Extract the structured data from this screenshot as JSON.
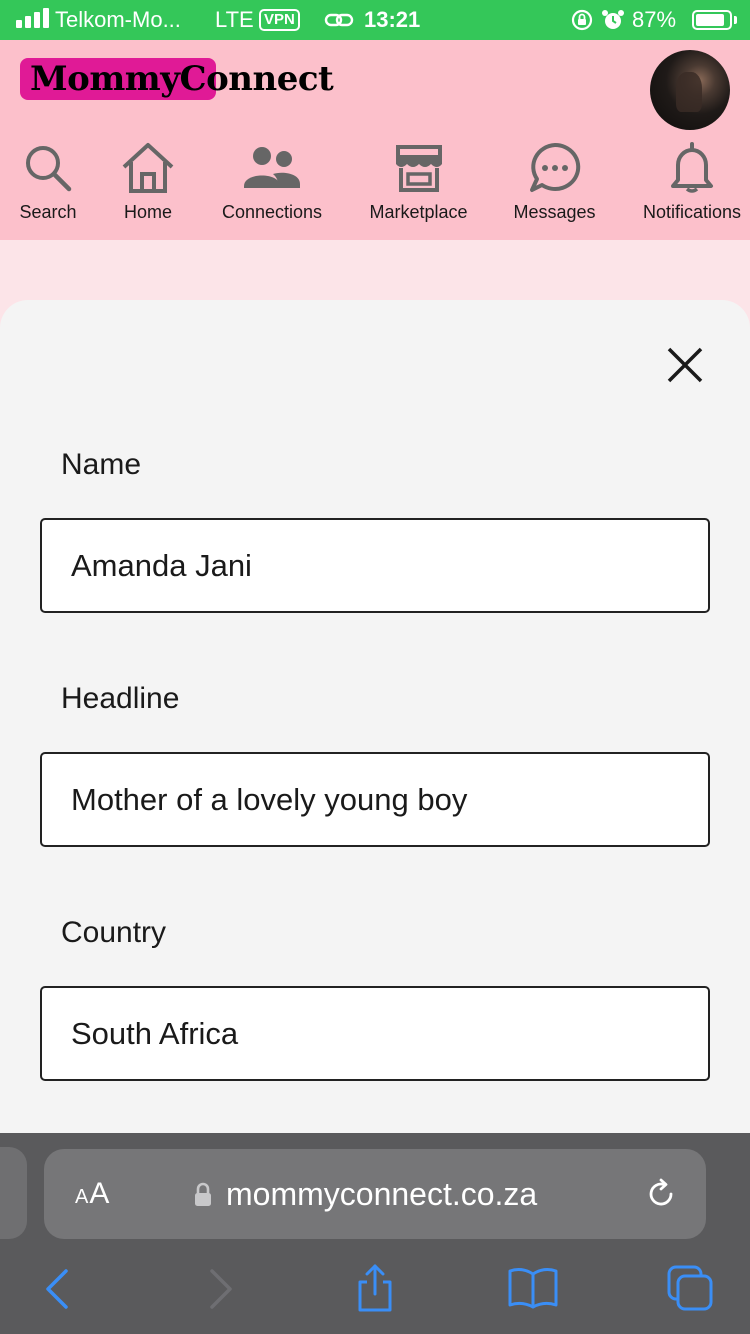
{
  "status_bar": {
    "carrier": "Telkom-Mo...",
    "network": "LTE",
    "vpn": "VPN",
    "time": "13:21",
    "battery": "87%",
    "battery_level": 0.87
  },
  "header": {
    "logo": "MommyConnect",
    "nav": [
      {
        "label": "Search",
        "icon": "search-icon"
      },
      {
        "label": "Home",
        "icon": "home-icon"
      },
      {
        "label": "Connections",
        "icon": "people-icon"
      },
      {
        "label": "Marketplace",
        "icon": "store-icon"
      },
      {
        "label": "Messages",
        "icon": "chat-bubble-icon"
      },
      {
        "label": "Notifications",
        "icon": "bell-icon"
      }
    ]
  },
  "form": {
    "name_label": "Name",
    "name_value": "Amanda Jani",
    "headline_label": "Headline",
    "headline_value": "Mother of a lovely young boy",
    "country_label": "Country",
    "country_value": "South Africa"
  },
  "browser": {
    "aa_label": "AA",
    "url": "mommyconnect.co.za"
  },
  "colors": {
    "status_bar": "#34c759",
    "header_bg": "#fcc0cb",
    "logo_highlight": "#e01a96",
    "browser_blue": "#3a8ef6"
  }
}
